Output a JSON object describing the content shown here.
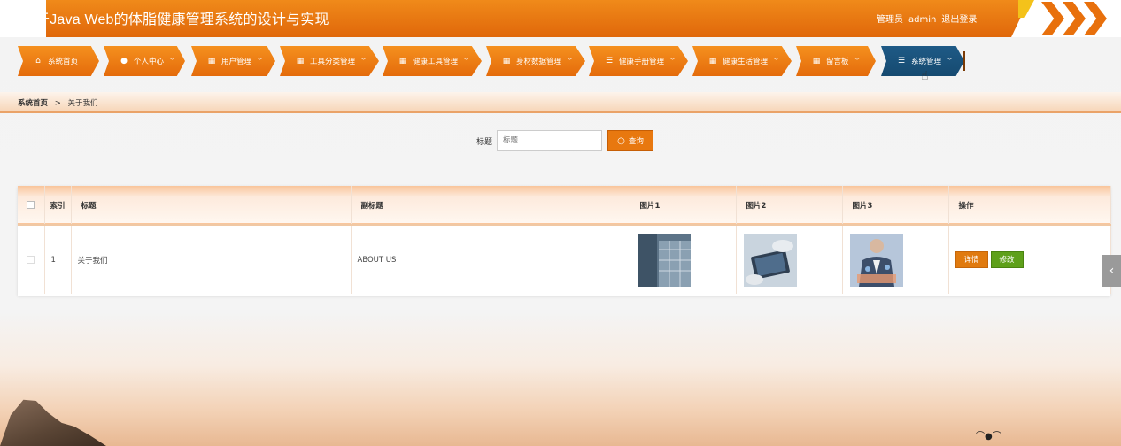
{
  "header": {
    "title": "于Java Web的体脂健康管理系统的设计与实现",
    "role_label": "管理员",
    "username": "admin",
    "logout_label": "退出登录"
  },
  "nav": {
    "items": [
      {
        "label": "系统首页",
        "icon": "home-icon",
        "dropdown": false
      },
      {
        "label": "个人中心",
        "icon": "user-icon",
        "dropdown": true
      },
      {
        "label": "用户管理",
        "icon": "grid-icon",
        "dropdown": true
      },
      {
        "label": "工具分类管理",
        "icon": "grid-icon",
        "dropdown": true
      },
      {
        "label": "健康工具管理",
        "icon": "grid-icon",
        "dropdown": true
      },
      {
        "label": "身材数据管理",
        "icon": "grid-icon",
        "dropdown": true
      },
      {
        "label": "健康手册管理",
        "icon": "list-icon",
        "dropdown": true
      },
      {
        "label": "健康生活管理",
        "icon": "grid-icon",
        "dropdown": true
      },
      {
        "label": "留言板",
        "icon": "grid-icon",
        "dropdown": true
      },
      {
        "label": "系统管理",
        "icon": "list-icon",
        "dropdown": true,
        "active": true
      }
    ]
  },
  "breadcrumb": {
    "home": "系统首页",
    "separator": ">",
    "current": "关于我们"
  },
  "search": {
    "label": "标题",
    "placeholder": "标题",
    "value": "",
    "button_label": "查询"
  },
  "table": {
    "columns": [
      "索引",
      "标题",
      "副标题",
      "图片1",
      "图片2",
      "图片3",
      "操作"
    ],
    "rows": [
      {
        "index": "1",
        "title": "关于我们",
        "subtitle": "ABOUT US",
        "detail_label": "详情",
        "edit_label": "修改"
      }
    ]
  },
  "colors": {
    "accent": "#e8780f",
    "active_nav": "#1e5a86",
    "edit_button": "#5ea01a"
  }
}
